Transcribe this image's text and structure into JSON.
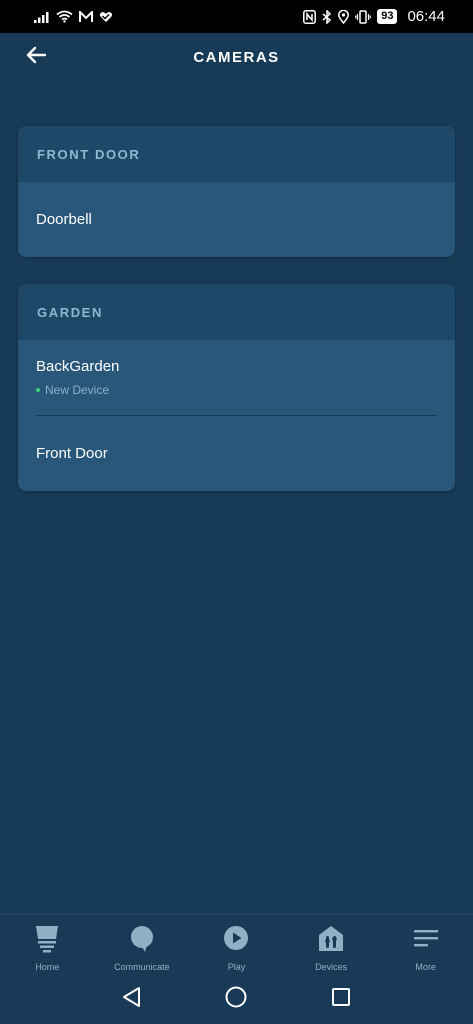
{
  "status_bar": {
    "time": "06:44",
    "battery": "93"
  },
  "header": {
    "title": "CAMERAS"
  },
  "groups": [
    {
      "title": "FRONT DOOR",
      "items": [
        {
          "name": "Doorbell"
        }
      ]
    },
    {
      "title": "GARDEN",
      "items": [
        {
          "name": "BackGarden",
          "status": "New Device"
        },
        {
          "name": "Front Door"
        }
      ]
    }
  ],
  "bottom_nav": [
    {
      "label": "Home",
      "icon": "home-icon"
    },
    {
      "label": "Communicate",
      "icon": "speech-bubble-icon"
    },
    {
      "label": "Play",
      "icon": "play-icon"
    },
    {
      "label": "Devices",
      "icon": "devices-house-icon"
    },
    {
      "label": "More",
      "icon": "menu-lines-icon"
    }
  ],
  "colors": {
    "background": "#173a56",
    "card": "#285779",
    "card_header": "#1f4868",
    "accent_text": "#8fb7cf",
    "status_green": "#37d07a"
  }
}
